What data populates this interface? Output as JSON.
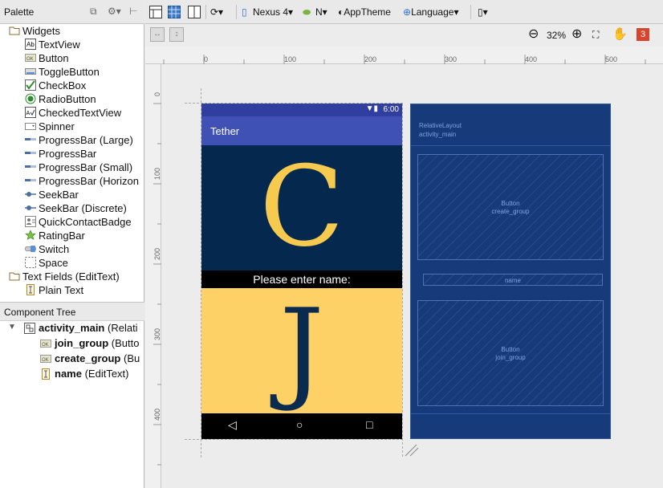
{
  "palette": {
    "title": "Palette",
    "categories": [
      {
        "label": "Widgets",
        "items": [
          {
            "label": "TextView",
            "icon": "textview-icon"
          },
          {
            "label": "Button",
            "icon": "button-icon"
          },
          {
            "label": "ToggleButton",
            "icon": "togglebutton-icon"
          },
          {
            "label": "CheckBox",
            "icon": "checkbox-icon"
          },
          {
            "label": "RadioButton",
            "icon": "radiobutton-icon"
          },
          {
            "label": "CheckedTextView",
            "icon": "checkedtextview-icon"
          },
          {
            "label": "Spinner",
            "icon": "spinner-icon"
          },
          {
            "label": "ProgressBar (Large)",
            "icon": "progressbar-icon"
          },
          {
            "label": "ProgressBar",
            "icon": "progressbar-icon"
          },
          {
            "label": "ProgressBar (Small)",
            "icon": "progressbar-icon"
          },
          {
            "label": "ProgressBar (Horizon",
            "icon": "progressbar-icon"
          },
          {
            "label": "SeekBar",
            "icon": "seekbar-icon"
          },
          {
            "label": "SeekBar (Discrete)",
            "icon": "seekbar-icon"
          },
          {
            "label": "QuickContactBadge",
            "icon": "contact-badge-icon"
          },
          {
            "label": "RatingBar",
            "icon": "star-icon"
          },
          {
            "label": "Switch",
            "icon": "switch-icon"
          },
          {
            "label": "Space",
            "icon": "space-icon"
          }
        ]
      },
      {
        "label": "Text Fields (EditText)",
        "items": [
          {
            "label": "Plain Text",
            "icon": "edittext-icon"
          }
        ]
      }
    ]
  },
  "component_tree": {
    "title": "Component Tree",
    "root": {
      "name": "activity_main",
      "type": "(Relati"
    },
    "children": [
      {
        "name": "join_group",
        "type": "(Butto"
      },
      {
        "name": "create_group",
        "type": "(Bu"
      },
      {
        "name": "name",
        "type": "(EditText)"
      }
    ]
  },
  "toolbar": {
    "device": "Nexus 4",
    "api": "N",
    "theme": "AppTheme",
    "language": "Language",
    "zoom": "32%",
    "warnings": "3"
  },
  "rulers": {
    "horizontal": [
      "0",
      "100",
      "200",
      "300",
      "400",
      "500"
    ],
    "vertical": [
      "0",
      "100",
      "200",
      "300",
      "400"
    ]
  },
  "phone": {
    "status_time": "6:00",
    "app_title": "Tether",
    "create_letter": "C",
    "name_hint": "Please enter name:",
    "join_letter": "J"
  },
  "blueprint": {
    "root_type": "RelativeLayout",
    "root_id": "activity_main",
    "create_type": "Button",
    "create_id": "create_group",
    "name_id": "name",
    "join_type": "Button",
    "join_id": "join_group"
  },
  "colors": {
    "primary_dark": "#303f9f",
    "primary": "#3f51b5",
    "create_bg": "#04284e",
    "create_letter": "#f6c94f",
    "join_bg": "#fed166",
    "join_letter": "#0a2a4f",
    "blueprint_bg": "#163a7a",
    "warning_badge": "#d9452c"
  }
}
